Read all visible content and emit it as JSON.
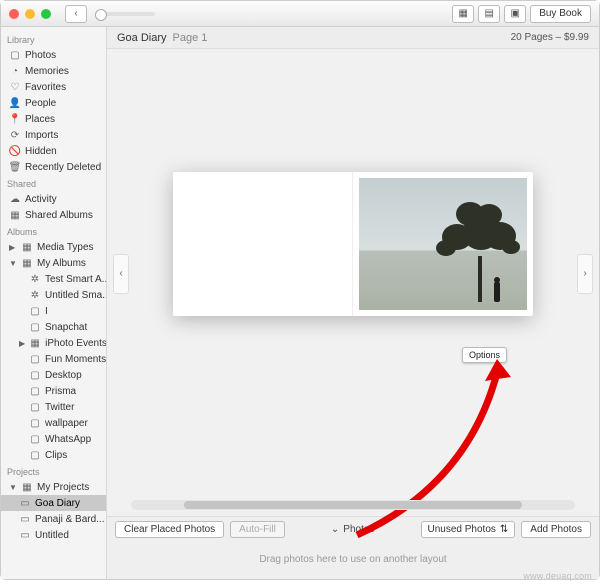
{
  "titlebar": {
    "buy_label": "Buy Book"
  },
  "header": {
    "title": "Goa Diary",
    "page_label": "Page 1",
    "summary": "20 Pages – $9.99"
  },
  "sidebar": {
    "sections": {
      "library": "Library",
      "shared": "Shared",
      "albums": "Albums",
      "projects": "Projects"
    },
    "library": [
      {
        "label": "Photos",
        "icon": "▢"
      },
      {
        "label": "Memories",
        "icon": "◔"
      },
      {
        "label": "Favorites",
        "icon": "♡"
      },
      {
        "label": "People",
        "icon": "👤"
      },
      {
        "label": "Places",
        "icon": "📍"
      },
      {
        "label": "Imports",
        "icon": "⟳"
      },
      {
        "label": "Hidden",
        "icon": "🚫"
      },
      {
        "label": "Recently Deleted",
        "icon": "🗑"
      }
    ],
    "shared": [
      {
        "label": "Activity",
        "icon": "☁"
      },
      {
        "label": "Shared Albums",
        "icon": "▦"
      }
    ],
    "albums": [
      {
        "label": "Media Types",
        "icon": "▦",
        "expand": "▶"
      },
      {
        "label": "My Albums",
        "icon": "▦",
        "expand": "▼"
      }
    ],
    "my_albums_children": [
      {
        "label": "Test Smart A..."
      },
      {
        "label": "Untitled Sma..."
      },
      {
        "label": "I"
      },
      {
        "label": "Snapchat"
      },
      {
        "label": "iPhoto Events",
        "expand": "▶"
      },
      {
        "label": "Fun Moments"
      },
      {
        "label": "Desktop"
      },
      {
        "label": "Prisma"
      },
      {
        "label": "Twitter"
      },
      {
        "label": "wallpaper"
      },
      {
        "label": "WhatsApp"
      },
      {
        "label": "Clips"
      }
    ],
    "projects": [
      {
        "label": "My Projects",
        "icon": "▦",
        "expand": "▼"
      }
    ],
    "my_projects_children": [
      {
        "label": "Goa Diary",
        "selected": true
      },
      {
        "label": "Panaji & Bard..."
      },
      {
        "label": "Untitled"
      }
    ]
  },
  "stage": {
    "options_label": "Options"
  },
  "toolbar": {
    "clear_label": "Clear Placed Photos",
    "autofill_label": "Auto-Fill",
    "photos_label": "Photos",
    "unused_label": "Unused Photos",
    "add_label": "Add Photos",
    "drag_hint": "Drag photos here to use on another layout"
  },
  "watermark": "www.deuaq.com"
}
